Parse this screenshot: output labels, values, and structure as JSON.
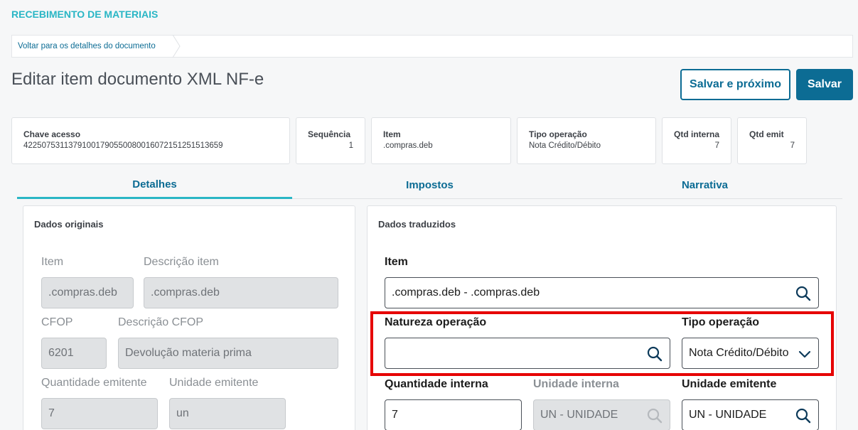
{
  "app": {
    "title": "RECEBIMENTO DE MATERIAIS"
  },
  "breadcrumb": {
    "link": "Voltar para os detalhes do documento"
  },
  "page": {
    "title": "Editar item documento XML NF-e"
  },
  "actions": {
    "save_next": "Salvar e próximo",
    "save": "Salvar"
  },
  "summary": {
    "chave": {
      "label": "Chave acesso",
      "value": "42250753113791001790550080016072151251513659"
    },
    "sequencia": {
      "label": "Sequência",
      "value": "1"
    },
    "item": {
      "label": "Item",
      "value": ".compras.deb"
    },
    "tipo_operacao": {
      "label": "Tipo operação",
      "value": "Nota Crédito/Débito"
    },
    "qtd_interna": {
      "label": "Qtd interna",
      "value": "7"
    },
    "qtd_emit": {
      "label": "Qtd emit",
      "value": "7"
    }
  },
  "tabs": [
    {
      "label": "Detalhes",
      "active": true
    },
    {
      "label": "Impostos",
      "active": false
    },
    {
      "label": "Narrativa",
      "active": false
    }
  ],
  "original": {
    "title": "Dados originais",
    "item_label": "Item",
    "item_value": ".compras.deb",
    "descricao_label": "Descrição item",
    "descricao_value": ".compras.deb",
    "cfop_label": "CFOP",
    "cfop_value": "6201",
    "desc_cfop_label": "Descrição CFOP",
    "desc_cfop_value": "Devolução materia prima",
    "qtd_label": "Quantidade emitente",
    "qtd_value": "7",
    "unidade_label": "Unidade emitente",
    "unidade_value": "un"
  },
  "translated": {
    "title": "Dados traduzidos",
    "item_label": "Item",
    "item_value": ".compras.deb - .compras.deb",
    "natureza_label": "Natureza operação",
    "natureza_value": "",
    "tipo_label": "Tipo operação",
    "tipo_value": "Nota Crédito/Débito",
    "qtd_interna_label": "Quantidade interna",
    "qtd_interna_value": "7",
    "unidade_interna_label": "Unidade interna",
    "unidade_interna_value": "UN - UNIDADE",
    "unidade_emit_label": "Unidade emitente",
    "unidade_emit_value": "UN - UNIDADE"
  },
  "colors": {
    "accent": "#29b6c5",
    "primary": "#0c6c94",
    "highlight": "#e60000"
  }
}
